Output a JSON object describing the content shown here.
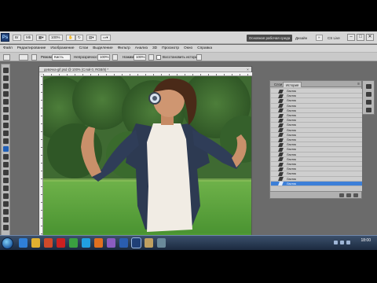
{
  "app": {
    "logo": "Ps",
    "zoom_value": "100%",
    "workspace_button": "Основная рабочая среда",
    "design_label": "Дизайн",
    "cslive_label": "CS Live",
    "window_controls": [
      "–",
      "□",
      "✕"
    ]
  },
  "menubar": [
    "Файл",
    "Редактирование",
    "Изображение",
    "Слои",
    "Выделение",
    "Фильтр",
    "Анализ",
    "3D",
    "Просмотр",
    "Окно",
    "Справка"
  ],
  "options": {
    "mode_label": "Режим:",
    "mode_value": "Кисть",
    "opacity_label": "Непрозрачность:",
    "opacity_value": "100%",
    "pressure_label": "Нажим:",
    "pressure_value": "100%",
    "history_label": "Восстановить историю"
  },
  "document": {
    "title": "девочка-gif.psd @ 100% (Слой 0, RGB/8) *",
    "close_symbol": "×"
  },
  "panel": {
    "tabs": [
      "Слои",
      "История"
    ],
    "menu_symbol": "≡",
    "history_items": [
      "Ластик",
      "Ластик",
      "Ластик",
      "Ластик",
      "Ластик",
      "Ластик",
      "Ластик",
      "Ластик",
      "Ластик",
      "Ластик",
      "Ластик",
      "Ластик",
      "Ластик",
      "Ластик",
      "Ластик",
      "Ластик",
      "Ластик",
      "Ластик",
      "Ластик",
      "Ластик"
    ],
    "selected_index": 19
  },
  "taskbar": {
    "clock_time": "18:00",
    "icons": [
      "ie-icon",
      "folder-icon",
      "media-icon",
      "opera-icon",
      "chrome-icon",
      "skype-icon",
      "firefox-icon",
      "paint-icon",
      "word-icon",
      "photoshop-icon",
      "explorer-icon",
      "app-icon"
    ]
  },
  "colors": {
    "workspace_bg": "#6b6b6b",
    "selection": "#3c7fd8",
    "foreground_swatch": "#cc5522",
    "background_swatch": "#ffffff"
  }
}
